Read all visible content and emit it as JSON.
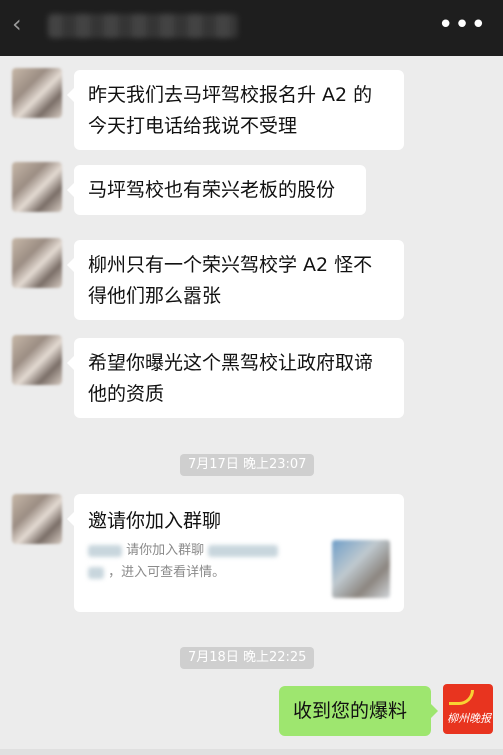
{
  "header": {
    "back_icon": "back-arrow-icon",
    "more_label": "•••"
  },
  "messages": [
    {
      "text_line1": "昨天我们去马坪驾校报名升 A2 的",
      "text_line2": "今天打电话给我说不受理"
    },
    {
      "text_line1": "马坪驾校也有荣兴老板的股份"
    },
    {
      "text_line1": "柳州只有一个荣兴驾校学 A2 怪不",
      "text_line2": "得他们那么嚣张"
    },
    {
      "text_line1": "希望你曝光这个黑驾校让政府取谛",
      "text_line2": "他的资质"
    }
  ],
  "timestamps": [
    "7月17日 晚上23:07",
    "7月18日 晚上22:25"
  ],
  "invite": {
    "title": "邀请你加入群聊",
    "desc_line1": "请你加入群聊",
    "desc_line2": "，进入可查看详情。"
  },
  "reply": {
    "text": "收到您的爆料",
    "logo_text": "柳州晚报"
  },
  "colors": {
    "topbar": "#1e1e1e",
    "background": "#ececec",
    "my_bubble": "#9ee66f",
    "brand_red": "#e8341f"
  }
}
